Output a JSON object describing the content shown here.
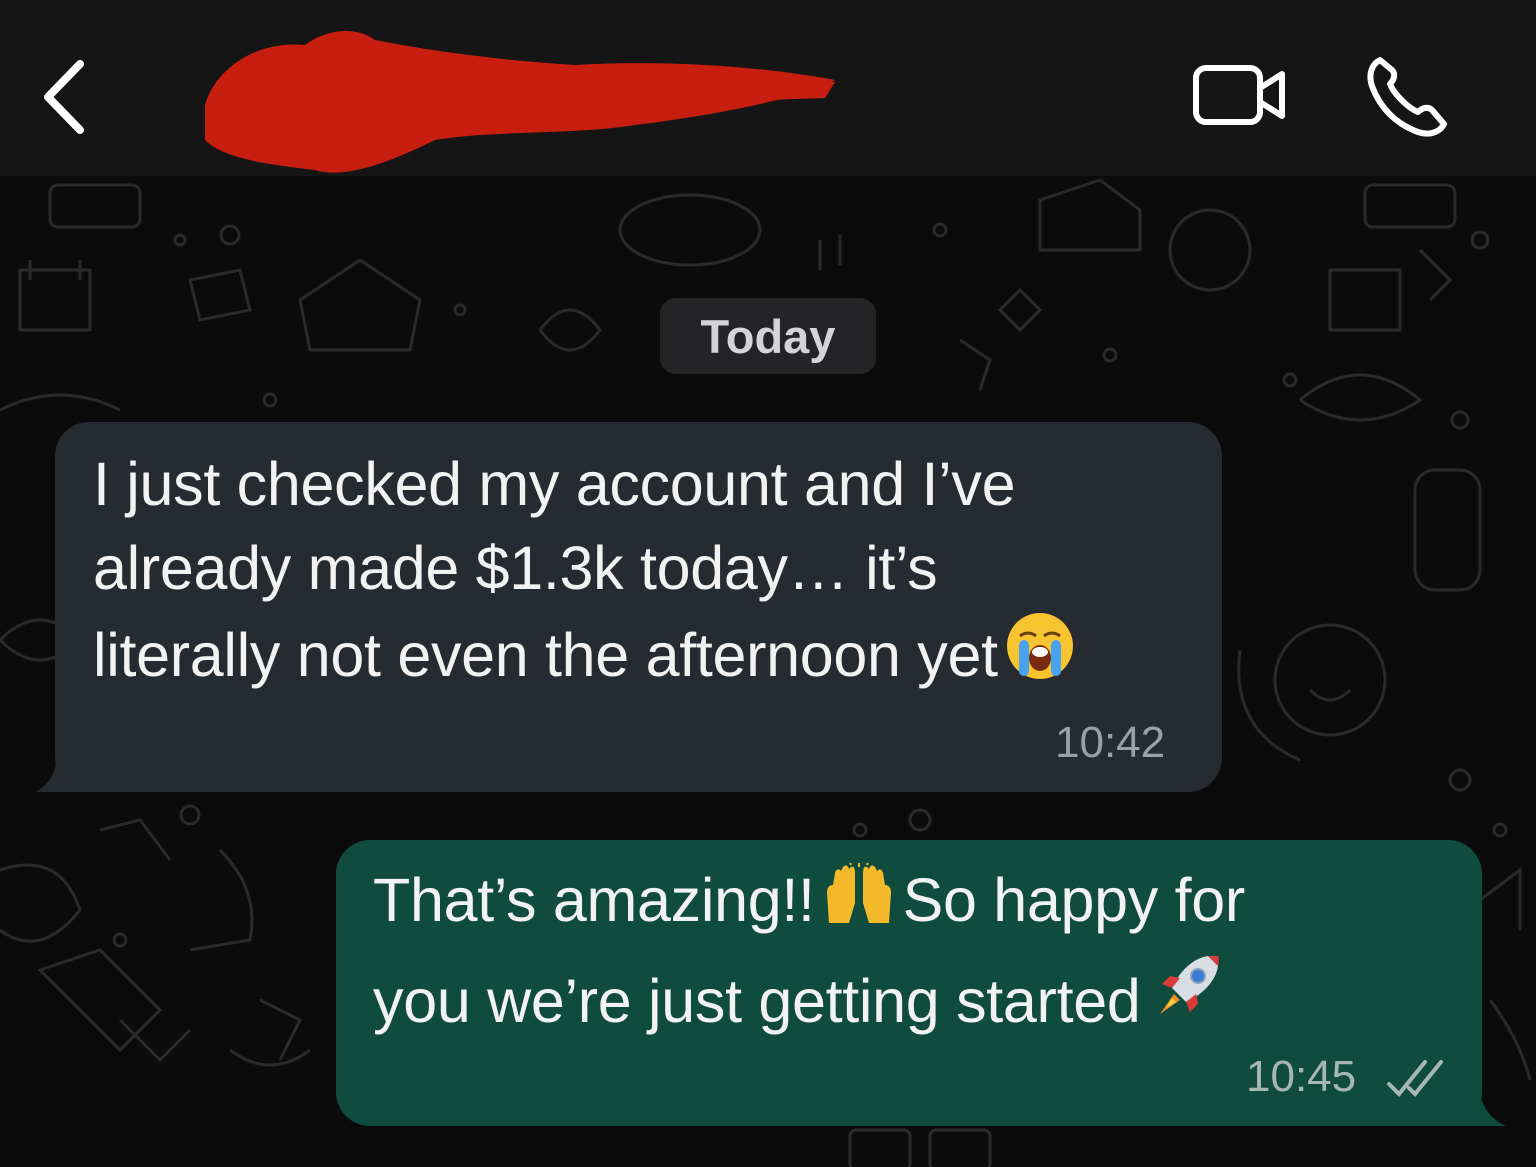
{
  "header": {
    "back_icon": "chevron-left-icon",
    "contact_name_redacted": true,
    "video_icon": "video-camera-icon",
    "call_icon": "phone-icon",
    "redaction_color": "#c81e0f"
  },
  "chat": {
    "date_label": "Today",
    "messages": [
      {
        "direction": "incoming",
        "lines": [
          "I just checked my account and I’ve",
          "already made $1.3k today… it’s",
          "literally not even the afternoon yet"
        ],
        "emoji": "😭",
        "time": "10:42"
      },
      {
        "direction": "outgoing",
        "line1_a": "That’s amazing!!",
        "emoji1": "🙌",
        "line1_b": "So happy for",
        "line2": "you we’re just getting started",
        "emoji2": "🚀",
        "time": "10:45",
        "status_icon": "double-check-icon"
      }
    ]
  },
  "colors": {
    "incoming_bubble": "#262a31",
    "outgoing_bubble": "#0f4c3d",
    "header_bg": "#151516",
    "wallpaper_bg": "#0b0b0c"
  }
}
